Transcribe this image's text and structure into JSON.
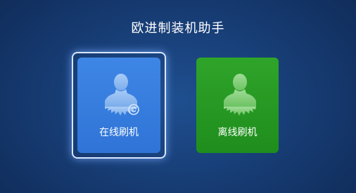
{
  "app": {
    "title": "欧进制装机助手"
  },
  "tiles": [
    {
      "label": "在线刷机",
      "icon": "person-broom-icon",
      "badge_icon": "sync-icon",
      "color": "#3a80e0",
      "selected": true
    },
    {
      "label": "离线刷机",
      "icon": "person-broom-icon",
      "color": "#27991f",
      "selected": false
    }
  ],
  "colors": {
    "background": "#1a4480",
    "selection_border": "#d7e6ff"
  }
}
